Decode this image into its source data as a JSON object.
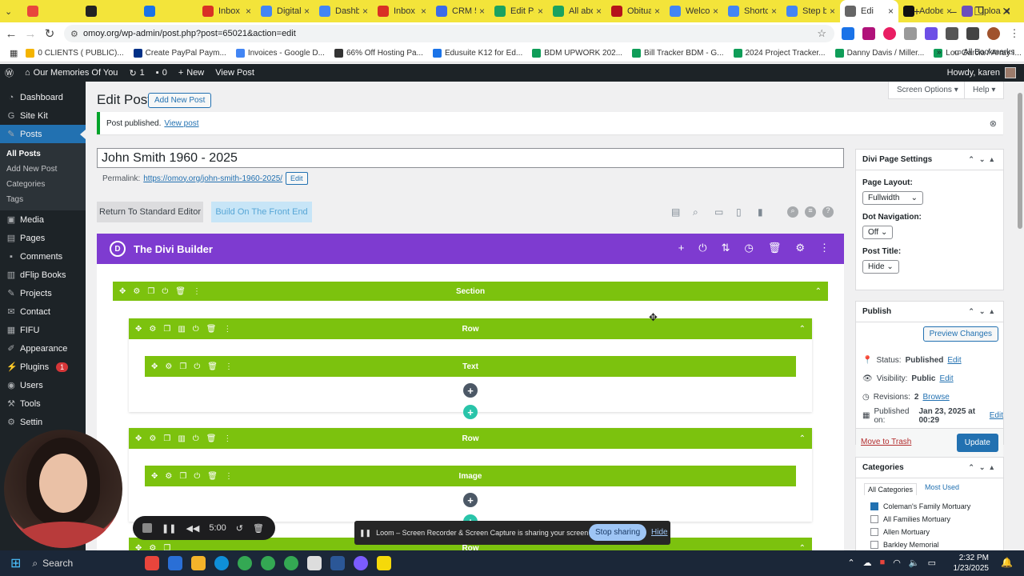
{
  "tabs": [
    {
      "label": "",
      "color": "#e8453c",
      "icon": "chrome-icon"
    },
    {
      "label": "",
      "color": "#222",
      "icon": "instagram-icon"
    },
    {
      "label": "",
      "color": "#1a73e8",
      "icon": "sparkle-icon"
    },
    {
      "label": "Inbox",
      "color": "#d93025",
      "icon": "gmail-icon"
    },
    {
      "label": "Digital",
      "color": "#4285f4",
      "icon": "drive-icon"
    },
    {
      "label": "Dashb",
      "color": "#4285f4",
      "icon": "analytics-icon"
    },
    {
      "label": "Inbox (",
      "color": "#d93025",
      "icon": "gmail-icon"
    },
    {
      "label": "CRM 5",
      "color": "#3b6ce8",
      "icon": "crm-icon"
    },
    {
      "label": "Edit Pa",
      "color": "#1aa260",
      "icon": "sheets-icon"
    },
    {
      "label": "All abo",
      "color": "#1aa260",
      "icon": "sheets-icon"
    },
    {
      "label": "Obitua",
      "color": "#b5121b",
      "icon": "obituary-icon"
    },
    {
      "label": "Welco",
      "color": "#4285f4",
      "icon": "docs-icon"
    },
    {
      "label": "Shortc",
      "color": "#4285f4",
      "icon": "docs-icon"
    },
    {
      "label": "Step by",
      "color": "#4285f4",
      "icon": "docs-icon"
    },
    {
      "label": "Edi",
      "color": "#666",
      "icon": "loading-icon",
      "active": true
    },
    {
      "label": "Adobe",
      "color": "#111",
      "icon": "adobe-icon"
    },
    {
      "label": "Uploa",
      "color": "#6b4fbb",
      "icon": "upload-icon"
    }
  ],
  "url": "omoy.org/wp-admin/post.php?post=65021&action=edit",
  "bookmarks": [
    {
      "label": "0 CLIENTS ( PUBLIC)...",
      "color": "#f4b400"
    },
    {
      "label": "Create PayPal Paym...",
      "color": "#003087"
    },
    {
      "label": "Invoices - Google D...",
      "color": "#4285f4"
    },
    {
      "label": "66% Off Hosting Pa...",
      "color": "#333"
    },
    {
      "label": "Edusuite K12 for Ed...",
      "color": "#1a73e8"
    },
    {
      "label": "BDM UPWORK 202...",
      "color": "#0f9d58"
    },
    {
      "label": "Bill Tracker BDM - G...",
      "color": "#0f9d58"
    },
    {
      "label": "2024 Project Tracker...",
      "color": "#0f9d58"
    },
    {
      "label": "Danny Davis / Miller...",
      "color": "#0f9d58"
    },
    {
      "label": "Lou Garcia / Array I...",
      "color": "#0f9d58"
    }
  ],
  "all_bookmarks": "All Bookmarks",
  "adminbar": {
    "site": "Our Memories Of You",
    "updates": "1",
    "comments": "0",
    "new": "New",
    "view": "View Post",
    "howdy": "Howdy, karen"
  },
  "menu": [
    {
      "label": "Dashboard",
      "icon": "dashboard-icon"
    },
    {
      "label": "Site Kit",
      "icon": "sitekit-icon"
    },
    {
      "label": "Posts",
      "icon": "pin-icon",
      "active": true
    },
    {
      "label": "Media",
      "icon": "media-icon"
    },
    {
      "label": "Pages",
      "icon": "pages-icon"
    },
    {
      "label": "Comments",
      "icon": "comments-icon"
    },
    {
      "label": "dFlip Books",
      "icon": "book-icon"
    },
    {
      "label": "Projects",
      "icon": "projects-icon"
    },
    {
      "label": "Contact",
      "icon": "mail-icon"
    },
    {
      "label": "FIFU",
      "icon": "image-icon"
    },
    {
      "label": "Appearance",
      "icon": "brush-icon"
    },
    {
      "label": "Plugins",
      "icon": "plugin-icon",
      "badge": "1"
    },
    {
      "label": "Users",
      "icon": "users-icon"
    },
    {
      "label": "Tools",
      "icon": "tools-icon"
    },
    {
      "label": "Settin",
      "icon": "settings-icon"
    }
  ],
  "submenu": [
    "All Posts",
    "Add New Post",
    "Categories",
    "Tags"
  ],
  "page": {
    "title": "Edit Post",
    "add_new": "Add New Post",
    "screen_options": "Screen Options ▾",
    "help": "Help ▾",
    "notice": "Post published.",
    "notice_link": "View post",
    "post_title": "John Smith 1960 - 2025",
    "permalink_label": "Permalink:",
    "permalink_url": "https://omoy.org/john-smith-1960-2025/",
    "permalink_edit": "Edit",
    "return_btn": "Return To Standard Editor",
    "frontend_btn": "Build On The Front End"
  },
  "builder": {
    "title": "The Divi Builder",
    "logo": "D",
    "section": "Section",
    "row1": "Row",
    "module1": "Text",
    "row2": "Row",
    "module2": "Image",
    "row3": "Row"
  },
  "divi_settings": {
    "title": "Divi Page Settings",
    "layout_label": "Page Layout:",
    "layout_value": "Fullwidth",
    "dot_label": "Dot Navigation:",
    "dot_value": "Off",
    "post_title_label": "Post Title:",
    "post_title_value": "Hide"
  },
  "publish": {
    "title": "Publish",
    "preview": "Preview Changes",
    "status_label": "Status:",
    "status_value": "Published",
    "visibility_label": "Visibility:",
    "visibility_value": "Public",
    "revisions_label": "Revisions:",
    "revisions_value": "2",
    "browse": "Browse",
    "published_on_label": "Published on:",
    "published_on_value": "Jan 23, 2025 at 00:29",
    "edit": "Edit",
    "trash": "Move to Trash",
    "update": "Update"
  },
  "categories": {
    "title": "Categories",
    "tab_all": "All Categories",
    "tab_used": "Most Used",
    "items": [
      {
        "label": "Coleman's Family Mortuary",
        "checked": true
      },
      {
        "label": "All Families Mortuary",
        "checked": false
      },
      {
        "label": "Allen Mortuary",
        "checked": false
      },
      {
        "label": "Barkley Memorial",
        "checked": false
      }
    ]
  },
  "recorder": {
    "time": "5:00"
  },
  "loom": {
    "message": "Loom – Screen Recorder & Screen Capture is sharing your screen and audio.",
    "stop": "Stop sharing",
    "hide": "Hide"
  },
  "taskbar": {
    "search": "Search",
    "time": "2:32 PM",
    "date": "1/23/2025"
  }
}
